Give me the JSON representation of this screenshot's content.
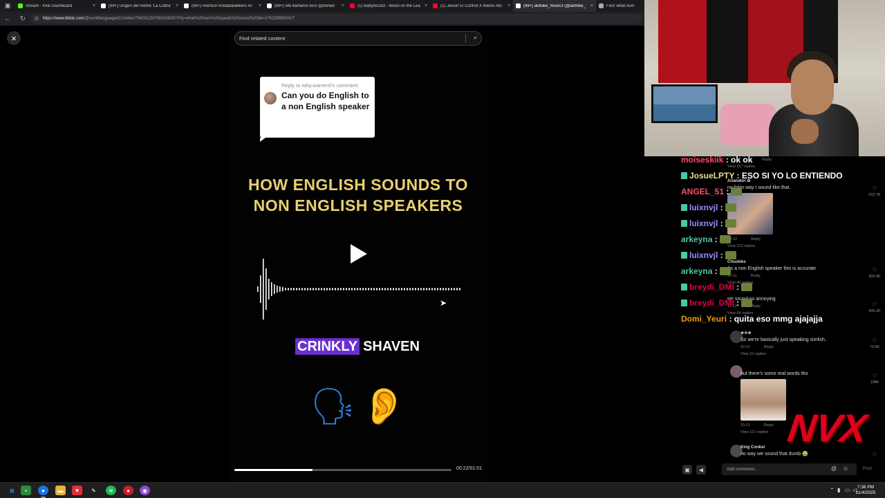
{
  "browser": {
    "tabs": [
      {
        "label": "Stream - Kick Dashboard",
        "color": "#53fc18",
        "active": false
      },
      {
        "label": "(99+) Origen del meme 'La Cobra'",
        "color": "#ffffff",
        "active": false
      },
      {
        "label": "(99+) #vertcol #rodadaubikers #c",
        "color": "#ffffff",
        "active": false
      },
      {
        "label": "(99+) Me llamaron loco @domidi",
        "color": "#ffffff",
        "active": false
      },
      {
        "label": "(1) Babylocc83 - Blood on the Lea",
        "color": "#ff0033",
        "active": false
      },
      {
        "label": "(1) Jeison El Control X Memo Ato",
        "color": "#ff0033",
        "active": false
      },
      {
        "label": "(99+) alofoke_music3 (@alofoke_",
        "color": "#ffffff",
        "active": true
      },
      {
        "label": "Find 'what num",
        "color": "#aaaaaa",
        "active": false
      }
    ],
    "url_host": "https://www.tiktok.com",
    "url_path": "/@worldlanguages01/video/7560012570841582870?q=what%20num%20speak%20sound%20&t=1762299500427"
  },
  "viewer": {
    "close_icon": "×",
    "search_placeholder": "Find related content",
    "reply_to": "Reply to toby.warren0's comment",
    "reply_question": "Can you do English to a non English speaker",
    "headline_line1": "HOW ENGLISH SOUNDS TO",
    "headline_line2": "NON ENGLISH SPEAKERS",
    "caption_word1": "CRINKLY",
    "caption_word2": "SHAVEN",
    "emoji_speaking": "🗣",
    "emoji_ear": "👂",
    "progress_fraction": 0.36,
    "progress_time": "00:22/01:01"
  },
  "comments": [
    {
      "id": "c0",
      "meta_reply": "Reply",
      "views": "View 257 replies"
    },
    {
      "id": "c1",
      "user": "Arianator ✿",
      "text": "no fckin way I sound like that.",
      "likes": "222.7K",
      "date": "10-12",
      "reply": "Reply",
      "views": "View 213 replies"
    },
    {
      "id": "c2",
      "user": "Chuckles",
      "text": "As a non English speaker this is accurate",
      "likes": "309.6K",
      "date": "10-11",
      "reply": "Reply",
      "views": "View 40 replies"
    },
    {
      "id": "c3",
      "user": "",
      "text": "we sound so annoying",
      "likes": "400.2K",
      "date": "10-12",
      "reply": "Reply",
      "views": "View 64 replies"
    },
    {
      "id": "c4",
      "user": "★✰★",
      "text": "So we're basically just speaking simlish..",
      "likes": "73.9K",
      "date": "10-11",
      "reply": "Reply",
      "views": "View 21 replies"
    },
    {
      "id": "c5",
      "user": "",
      "text": "but there's some real words tho",
      "likes": "108K",
      "date": "10-11",
      "reply": "Reply",
      "views": "View 121 replies"
    },
    {
      "id": "c6",
      "user": "King Conker",
      "text": "no way we sound that dumb 😭",
      "likes": ""
    }
  ],
  "chat": [
    {
      "user": "moiseskiik",
      "msg": ": ok ok",
      "color": "#ff4d6d",
      "badge": false,
      "emote": false
    },
    {
      "user": "JosueLPTY",
      "msg": ": ESO SI YO LO ENTIENDO",
      "color": "#e8e08c",
      "badge": true,
      "emote": false
    },
    {
      "user": "ANGEL_51",
      "msg": ":",
      "color": "#ff4d6d",
      "badge": false,
      "emote": true
    },
    {
      "user": "luixnvjl",
      "msg": ":",
      "color": "#9b8cff",
      "badge": true,
      "emote": true
    },
    {
      "user": "luixnvjl",
      "msg": ":",
      "color": "#9b8cff",
      "badge": true,
      "emote": true
    },
    {
      "user": "arkeyna",
      "msg": ":",
      "color": "#47c9a7",
      "badge": false,
      "emote": true
    },
    {
      "user": "luixnvjl",
      "msg": ":",
      "color": "#9b8cff",
      "badge": true,
      "emote": true
    },
    {
      "user": "arkeyna",
      "msg": ":",
      "color": "#47c9a7",
      "badge": false,
      "emote": true
    },
    {
      "user": "breydi_DMI",
      "msg": ":",
      "color": "#e0004a",
      "badge": true,
      "emote": true
    },
    {
      "user": "breydi_DMI",
      "msg": ":",
      "color": "#e0004a",
      "badge": true,
      "emote": true
    },
    {
      "user": "Domi_Yeuri",
      "msg": ": quita eso mmg ajajajja",
      "color": "#e8a100",
      "badge": false,
      "emote": false
    }
  ],
  "overlay_logo": "NVX",
  "comment_bar": {
    "placeholder": "Add comment...",
    "at_icon": "@",
    "emoji_icon": "☺",
    "post": "Post"
  },
  "taskbar": {
    "time": "7:38 PM",
    "date": "11/4/2025"
  }
}
